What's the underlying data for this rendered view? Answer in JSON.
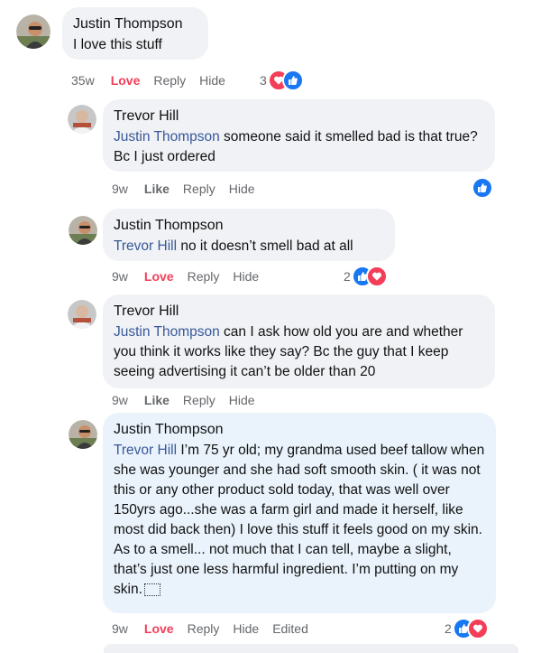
{
  "comments": [
    {
      "author": "Justin Thompson",
      "text": "I love this stuff",
      "time": "35w",
      "reaction_label": "Love",
      "reply_label": "Reply",
      "hide_label": "Hide",
      "reaction_count": "3"
    },
    {
      "author": "Trevor Hill",
      "mention": "Justin Thompson",
      "text": " someone said it smelled bad is that true? Bc I just ordered",
      "time": "9w",
      "reaction_label": "Like",
      "reply_label": "Reply",
      "hide_label": "Hide"
    },
    {
      "author": "Justin Thompson",
      "mention": "Trevor Hill",
      "text": " no it doesn’t smell bad at all",
      "time": "9w",
      "reaction_label": "Love",
      "reply_label": "Reply",
      "hide_label": "Hide",
      "reaction_count": "2"
    },
    {
      "author": "Trevor Hill",
      "mention": "Justin Thompson",
      "text": " can I ask how old you are and whether you think it works like they say? Bc the guy that I keep seeing advertising it can’t be older than 20",
      "time": "9w",
      "reaction_label": "Like",
      "reply_label": "Reply",
      "hide_label": "Hide"
    },
    {
      "author": "Justin Thompson",
      "mention": "Trevor Hill",
      "text": " I’m 75 yr old; my grandma used beef tallow when she was younger and she had soft smooth skin. ( it was not this or any other product sold today, that was well over 150yrs ago...she was a farm girl and made it herself, like most did back then) I love this stuff it feels good on my skin. As to a smell... not much that I can tell, maybe a slight, that’s just one less harmful ingredient. I’m putting on my skin.",
      "time": "9w",
      "reaction_label": "Love",
      "reply_label": "Reply",
      "hide_label": "Hide",
      "edited_label": "Edited",
      "reaction_count": "2"
    }
  ],
  "colors": {
    "like_blue": "#1877f2",
    "love_red": "#f33e58",
    "mention_blue": "#385898",
    "meta_gray": "#65676b"
  },
  "icons": [
    "avatar",
    "like-icon",
    "love-icon",
    "emoji-icon"
  ]
}
